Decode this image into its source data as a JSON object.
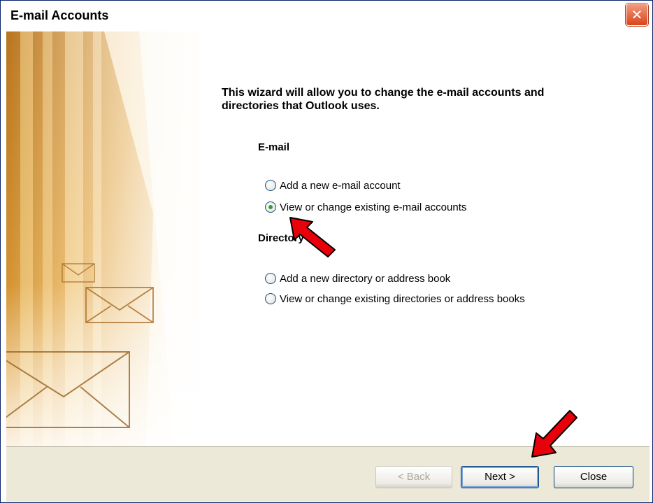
{
  "window": {
    "title": "E-mail Accounts",
    "close_glyph": "✕"
  },
  "intro": {
    "text": "This wizard will allow you to change the e-mail accounts and directories that Outlook uses."
  },
  "email_section": {
    "heading": "E-mail",
    "options": [
      {
        "label": "Add a new e-mail account",
        "checked": false
      },
      {
        "label": "View or change existing e-mail accounts",
        "checked": true
      }
    ]
  },
  "directory_section": {
    "heading": "Directory",
    "options": [
      {
        "label": "Add a new directory or address book",
        "checked": false
      },
      {
        "label": "View or change existing directories or address books",
        "checked": false
      }
    ]
  },
  "buttons": {
    "back": "< Back",
    "next": "Next >",
    "close": "Close"
  },
  "colors": {
    "annotation_arrow": "#e8000a",
    "radio_checked_dot": "#2aa03a",
    "panel_bg": "#ece9d8",
    "art_gold": "#e0a038"
  },
  "icons": {
    "close": "close-icon",
    "envelopes": "envelope-icon",
    "annotation": "arrow-icon"
  }
}
